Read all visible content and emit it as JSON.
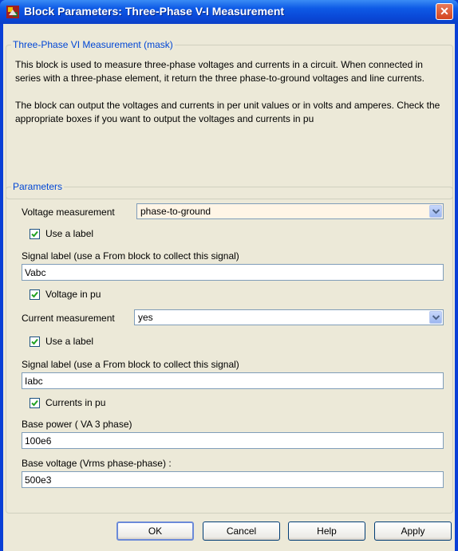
{
  "window": {
    "title": "Block Parameters: Three-Phase V-I Measurement",
    "close_label": "✕"
  },
  "mask": {
    "legend": "Three-Phase VI Measurement (mask)",
    "paragraph1": "This block is used to measure three-phase voltages and currents in a circuit. When connected in series with a  three-phase element, it return the three phase-to-ground voltages and line currents.",
    "paragraph2": "The block can output the voltages and currents in per unit values or in volts and amperes. Check the appropriate boxes if you want to output the voltages and currents in pu"
  },
  "params": {
    "legend": "Parameters",
    "voltage_measurement": {
      "label": "Voltage measurement",
      "value": "phase-to-ground"
    },
    "voltage_use_label": {
      "label": "Use a label",
      "checked": true
    },
    "voltage_signal_label": {
      "label": "Signal label  (use a From block to collect this signal)",
      "value": "Vabc"
    },
    "voltage_in_pu": {
      "label": "Voltage  in pu",
      "checked": true
    },
    "current_measurement": {
      "label": "Current measurement",
      "value": "yes"
    },
    "current_use_label": {
      "label": "Use a label",
      "checked": true
    },
    "current_signal_label": {
      "label": "Signal label  (use a From block to collect this signal)",
      "value": "Iabc"
    },
    "currents_in_pu": {
      "label": "Currents in pu",
      "checked": true
    },
    "base_power": {
      "label": "Base power ( VA 3 phase)",
      "value": "100e6"
    },
    "base_voltage": {
      "label": "Base voltage (Vrms phase-phase) :",
      "value": "500e3"
    }
  },
  "buttons": {
    "ok": "OK",
    "cancel": "Cancel",
    "help": "Help",
    "apply": "Apply"
  },
  "icons": {
    "app": "simulink-block-icon",
    "close": "close-icon",
    "dropdown": "chevron-down-icon",
    "check": "checkmark-icon"
  }
}
